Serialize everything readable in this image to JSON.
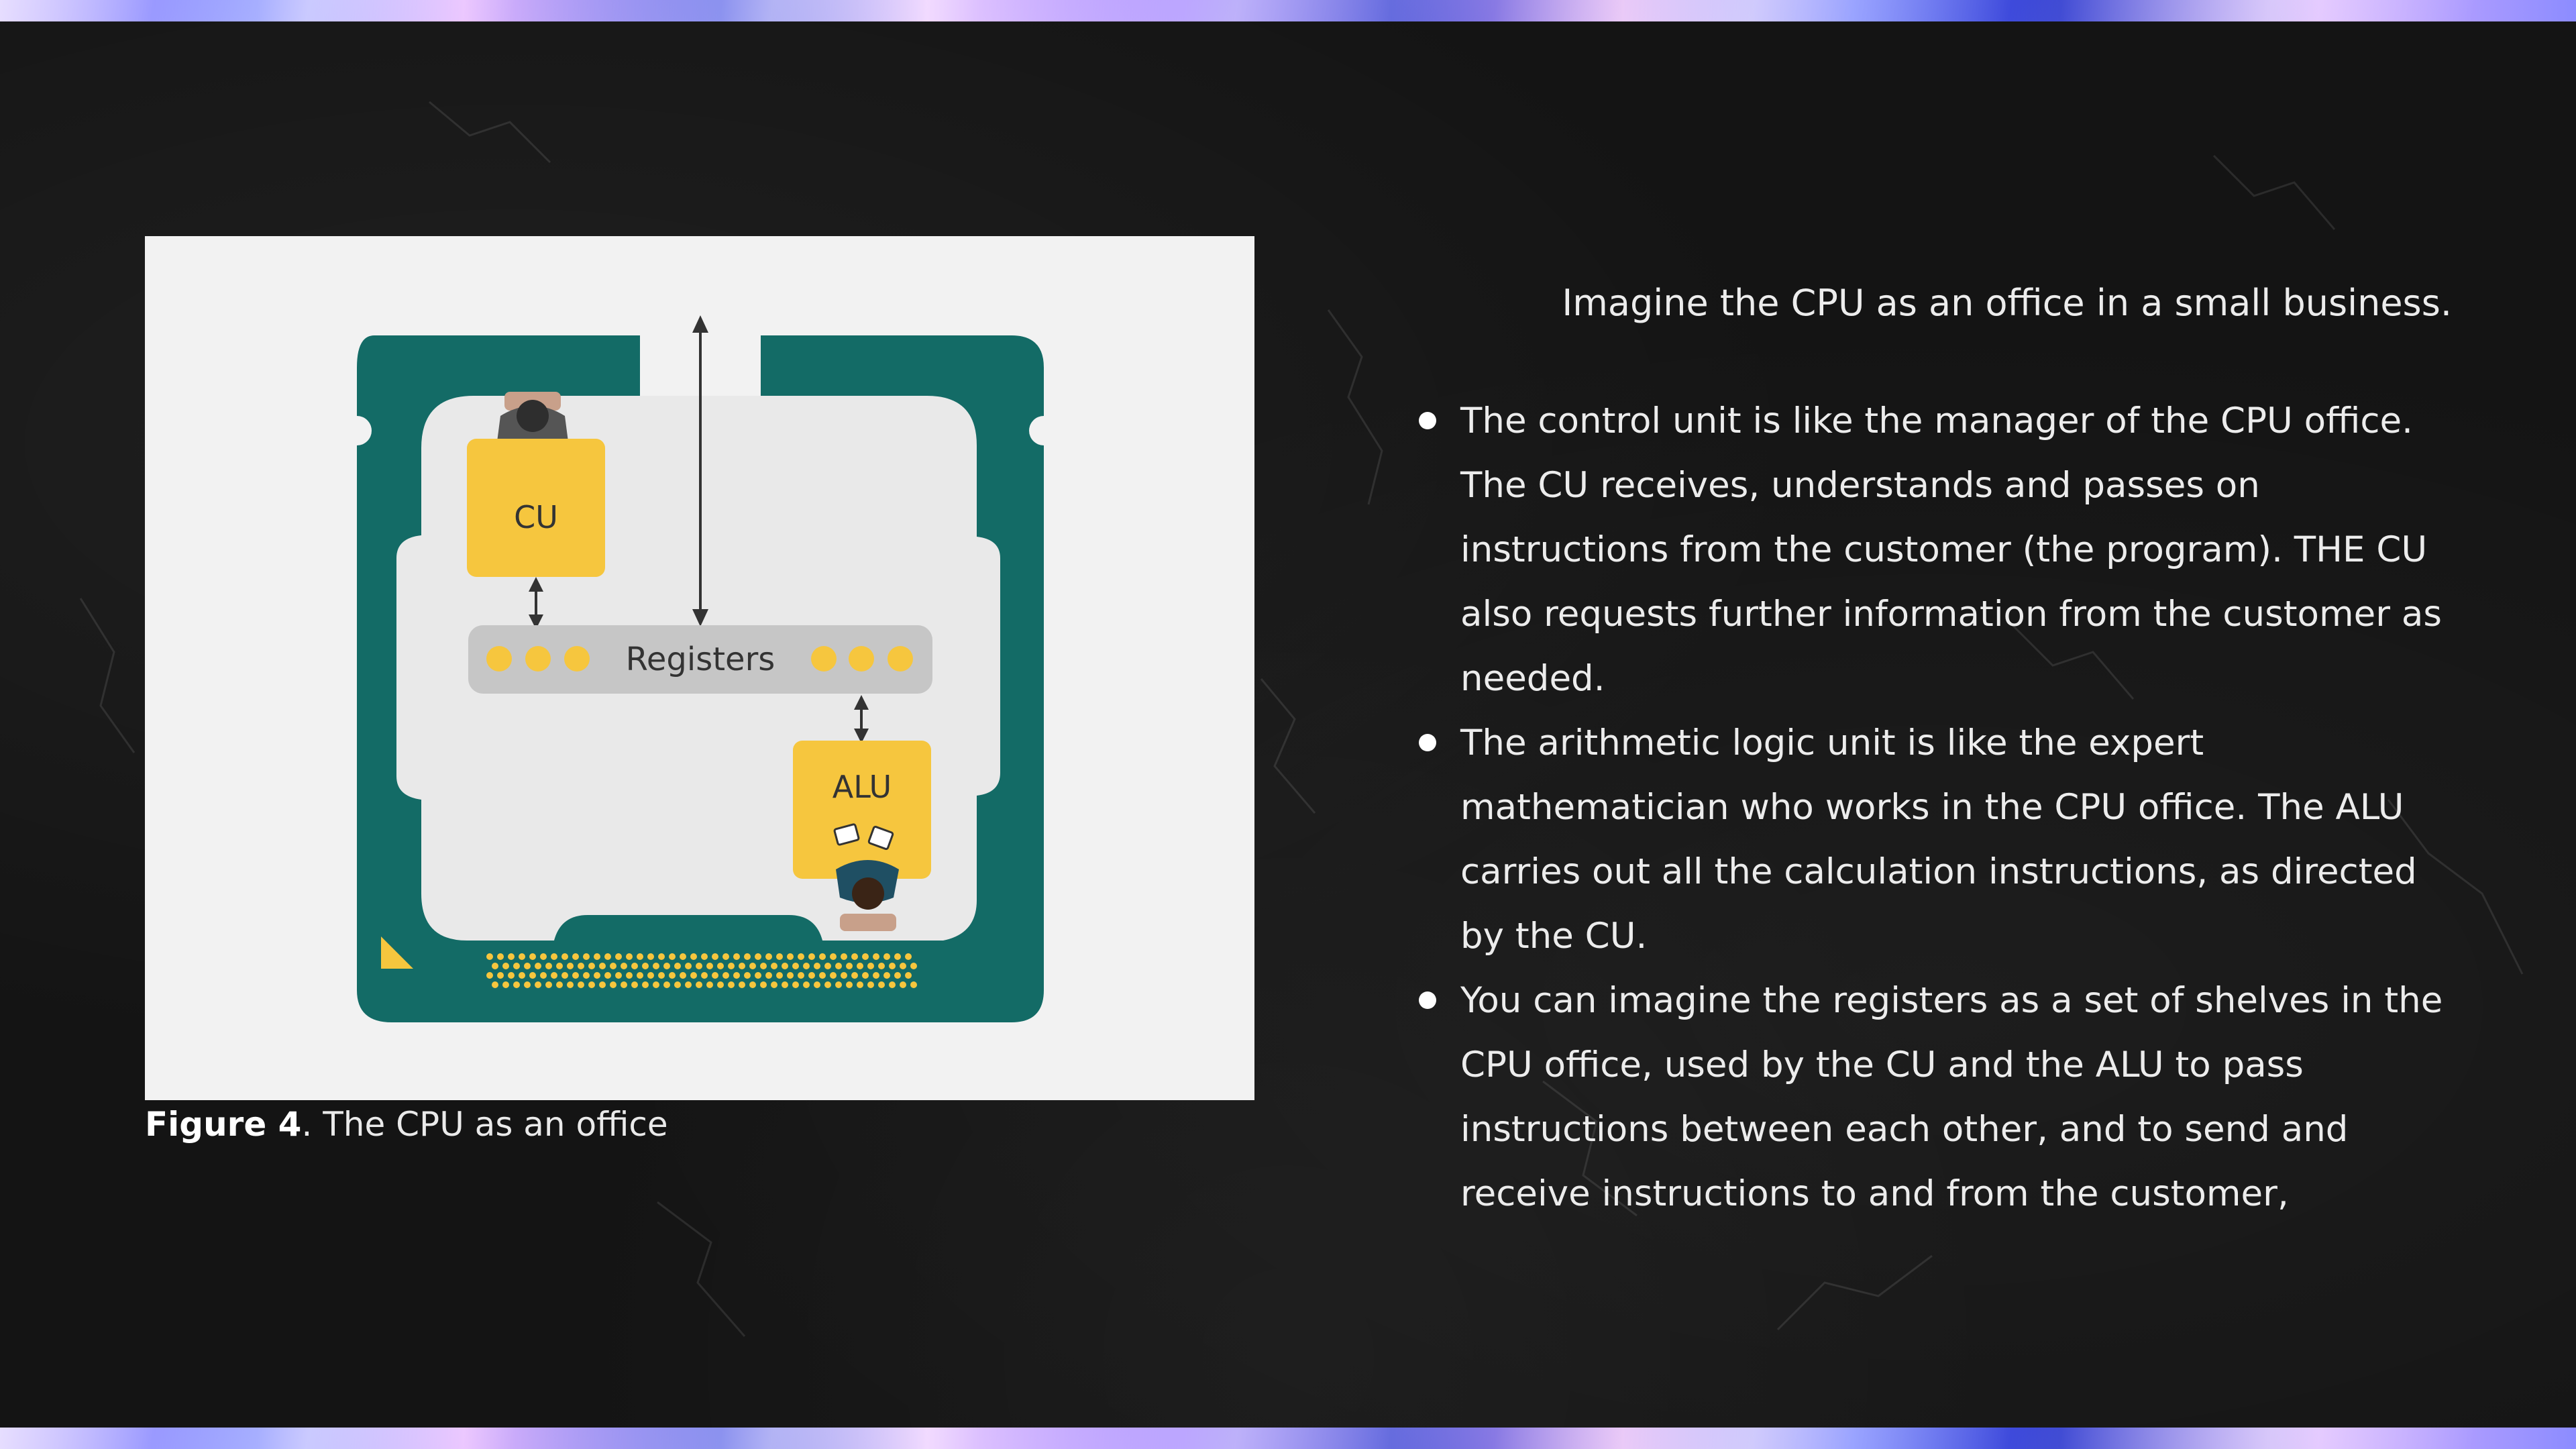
{
  "figure": {
    "cu_label": "CU",
    "registers_label": "Registers",
    "alu_label": "ALU",
    "caption_bold": "Figure 4",
    "caption_rest": ". The CPU as an office"
  },
  "text": {
    "intro": "Imagine the CPU as an office in a small business.",
    "bullets": [
      "The control unit is like the manager of the CPU office. The CU receives, understands and passes on instructions from the customer (the program). THE CU also requests further information from the customer as needed.",
      "The arithmetic logic unit is like the expert mathematician who works in the CPU office. The ALU carries out all the calculation instructions, as directed by the CU.",
      "You can imagine the registers as a set of shelves in the CPU office, used by the CU and the ALU to pass instructions between each other, and to send and receive instructions to and from the customer,"
    ]
  },
  "colors": {
    "chip": "#136b66",
    "unit": "#f6c63e",
    "registers_bar": "#c6c6c6",
    "background": "#141414"
  },
  "icons": [
    "manager-figure-icon",
    "mathematician-figure-icon",
    "chip-notch-icon",
    "pin-row-icon"
  ]
}
